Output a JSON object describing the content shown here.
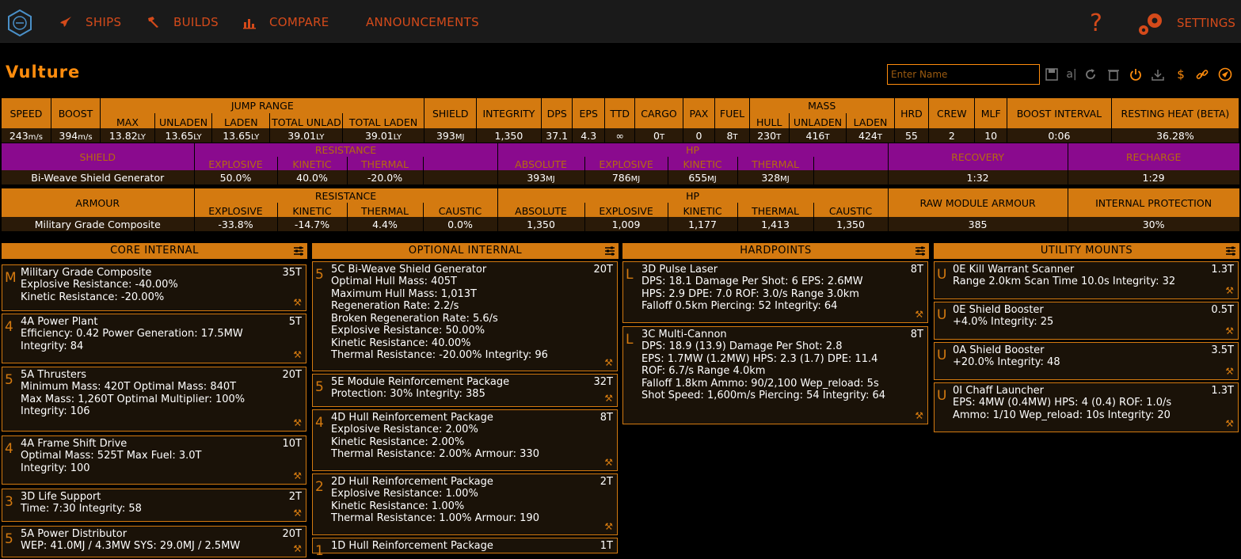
{
  "nav": {
    "ships": "SHIPS",
    "builds": "BUILDS",
    "compare": "COMPARE",
    "announcements": "ANNOUNCEMENTS",
    "help": "?",
    "settings": "SETTINGS"
  },
  "ship": {
    "name": "Vulture",
    "name_placeholder": "Enter Name"
  },
  "colors": {
    "accent": "#ff8c0d",
    "header": "#d47a10",
    "shield_row": "#8a0a8e",
    "nav_text": "#d44a1a"
  },
  "summary": {
    "headers": {
      "speed": "SPEED",
      "boost": "BOOST",
      "jump_range": "JUMP RANGE",
      "max": "MAX",
      "unladen": "UNLADEN",
      "laden": "LADEN",
      "total_unladen": "TOTAL UNLADEN",
      "total_laden": "TOTAL LADEN",
      "shield": "SHIELD",
      "integrity": "INTEGRITY",
      "dps": "DPS",
      "eps": "EPS",
      "ttd": "TTD",
      "cargo": "CARGO",
      "pax": "PAX",
      "fuel": "FUEL",
      "mass": "MASS",
      "hull": "HULL",
      "m_unladen": "UNLADEN",
      "m_laden": "LADEN",
      "hrd": "HRD",
      "crew": "CREW",
      "mlf": "MLF",
      "boost_interval": "BOOST INTERVAL",
      "resting_heat": "RESTING HEAT (BETA)"
    },
    "values": {
      "speed": "243",
      "speed_u": "m/s",
      "boost": "394",
      "boost_u": "m/s",
      "max": "13.82",
      "max_u": "LY",
      "unladen": "13.65",
      "unladen_u": "LY",
      "laden": "13.65",
      "laden_u": "LY",
      "total_unladen": "39.01",
      "total_unladen_u": "LY",
      "total_laden": "39.01",
      "total_laden_u": "LY",
      "shield": "393",
      "shield_u": "MJ",
      "integrity": "1,350",
      "dps": "37.1",
      "eps": "4.3",
      "ttd": "∞",
      "cargo": "0",
      "cargo_u": "T",
      "pax": "0",
      "fuel": "8",
      "fuel_u": "T",
      "hull": "230",
      "hull_u": "T",
      "m_unladen": "416",
      "m_unladen_u": "T",
      "m_laden": "424",
      "m_laden_u": "T",
      "hrd": "55",
      "crew": "2",
      "mlf": "10",
      "boost_interval": "0:06",
      "resting_heat": "36.28%"
    }
  },
  "shield_table": {
    "shield": "SHIELD",
    "resistance": "RESISTANCE",
    "explosive": "EXPLOSIVE",
    "kinetic": "KINETIC",
    "thermal": "THERMAL",
    "hp": "HP",
    "absolute": "ABSOLUTE",
    "recovery": "RECOVERY",
    "recharge": "RECHARGE",
    "row": {
      "name": "Bi-Weave Shield Generator",
      "r_exp": "50.0%",
      "r_kin": "40.0%",
      "r_the": "-20.0%",
      "hp_abs": "393",
      "hp_exp": "786",
      "hp_kin": "655",
      "hp_the": "328",
      "unit": "MJ",
      "recovery": "1:32",
      "recharge": "1:29"
    }
  },
  "armour_table": {
    "armour": "ARMOUR",
    "resistance": "RESISTANCE",
    "explosive": "EXPLOSIVE",
    "kinetic": "KINETIC",
    "thermal": "THERMAL",
    "caustic": "CAUSTIC",
    "hp": "HP",
    "absolute": "ABSOLUTE",
    "raw": "RAW MODULE ARMOUR",
    "internal": "INTERNAL PROTECTION",
    "row": {
      "name": "Military Grade Composite",
      "r_exp": "-33.8%",
      "r_kin": "-14.7%",
      "r_the": "4.4%",
      "r_cau": "0.0%",
      "hp_abs": "1,350",
      "hp_exp": "1,009",
      "hp_kin": "1,177",
      "hp_the": "1,413",
      "hp_cau": "1,350",
      "raw": "385",
      "internal": "30%"
    }
  },
  "columns": {
    "core": {
      "title": "CORE INTERNAL",
      "modules": [
        {
          "cls": "M",
          "name": "Military Grade Composite",
          "mass": "35T",
          "lines": [
            "Explosive Resistance: -40.00%",
            "Kinetic Resistance: -20.00%"
          ]
        },
        {
          "cls": "4",
          "name": "4A Power Plant",
          "mass": "5T",
          "lines": [
            "Efficiency: 0.42   Power Generation: 17.5MW",
            "Integrity: 84"
          ]
        },
        {
          "cls": "5",
          "name": "5A Thrusters",
          "mass": "20T",
          "lines": [
            "Minimum Mass: 420T   Optimal Mass: 840T",
            "Max Mass: 1,260T   Optimal Multiplier: 100%",
            "Integrity: 106"
          ]
        },
        {
          "cls": "4",
          "name": "4A Frame Shift Drive",
          "mass": "10T",
          "lines": [
            "Optimal Mass: 525T   Max Fuel: 3.0T",
            "Integrity: 100"
          ]
        },
        {
          "cls": "3",
          "name": "3D Life Support",
          "mass": "2T",
          "lines": [
            "Time: 7:30   Integrity: 58"
          ]
        },
        {
          "cls": "5",
          "name": "5A Power Distributor",
          "mass": "20T",
          "lines": [
            "WEP: 41.0MJ / 4.3MW   SYS: 29.0MJ / 2.5MW"
          ]
        }
      ]
    },
    "optional": {
      "title": "OPTIONAL INTERNAL",
      "modules": [
        {
          "cls": "5",
          "name": "5C Bi-Weave Shield Generator",
          "mass": "20T",
          "lines": [
            "Optimal Hull Mass: 405T",
            "Maximum Hull Mass: 1,013T",
            "Regeneration Rate: 2.2/s",
            "Broken Regeneration Rate: 5.6/s",
            "Explosive Resistance: 50.00%",
            "Kinetic Resistance: 40.00%",
            "Thermal Resistance: -20.00%   Integrity: 96"
          ]
        },
        {
          "cls": "5",
          "name": "5E Module Reinforcement Package",
          "mass": "32T",
          "lines": [
            "Protection: 30%   Integrity: 385"
          ]
        },
        {
          "cls": "4",
          "name": "4D Hull Reinforcement Package",
          "mass": "8T",
          "lines": [
            "Explosive Resistance: 2.00%",
            "Kinetic Resistance: 2.00%",
            "Thermal Resistance: 2.00%   Armour: 330"
          ]
        },
        {
          "cls": "2",
          "name": "2D Hull Reinforcement Package",
          "mass": "2T",
          "lines": [
            "Explosive Resistance: 1.00%",
            "Kinetic Resistance: 1.00%",
            "Thermal Resistance: 1.00%   Armour: 190"
          ]
        },
        {
          "cls": "1",
          "name": "1D Hull Reinforcement Package",
          "mass": "1T",
          "lines": []
        }
      ]
    },
    "hardpoints": {
      "title": "HARDPOINTS",
      "modules": [
        {
          "cls": "L",
          "name": "3D Pulse Laser",
          "mass": "8T",
          "lines": [
            "DPS: 18.1   Damage Per Shot: 6   EPS: 2.6MW",
            "HPS: 2.9   DPE: 7.0   ROF: 3.0/s   Range 3.0km",
            "Falloff 0.5km   Piercing: 52   Integrity: 64"
          ]
        },
        {
          "cls": "L",
          "name": "3C Multi-Cannon",
          "mass": "8T",
          "lines": [
            "DPS: 18.9 (13.9)   Damage Per Shot: 2.8",
            "EPS: 1.7MW (1.2MW)   HPS: 2.3 (1.7)   DPE: 11.4",
            "ROF: 6.7/s   Range 4.0km",
            "Falloff 1.8km   Ammo: 90/2,100   Wep_reload: 5s",
            "Shot Speed: 1,600m/s   Piercing: 54   Integrity: 64"
          ]
        }
      ]
    },
    "utility": {
      "title": "UTILITY MOUNTS",
      "modules": [
        {
          "cls": "U",
          "name": "0E Kill Warrant Scanner",
          "mass": "1.3T",
          "lines": [
            "Range 2.0km   Scan Time 10.0s   Integrity: 32"
          ]
        },
        {
          "cls": "U",
          "name": "0E Shield Booster",
          "mass": "0.5T",
          "lines": [
            "+4.0%   Integrity: 25"
          ]
        },
        {
          "cls": "U",
          "name": "0A Shield Booster",
          "mass": "3.5T",
          "lines": [
            "+20.0%   Integrity: 48"
          ]
        },
        {
          "cls": "U",
          "name": "0I Chaff Launcher",
          "mass": "1.3T",
          "lines": [
            "EPS: 4MW (0.4MW)   HPS: 4 (0.4)   ROF: 1.0/s",
            "Ammo: 1/10   Wep_reload: 10s   Integrity: 20"
          ]
        }
      ]
    }
  }
}
